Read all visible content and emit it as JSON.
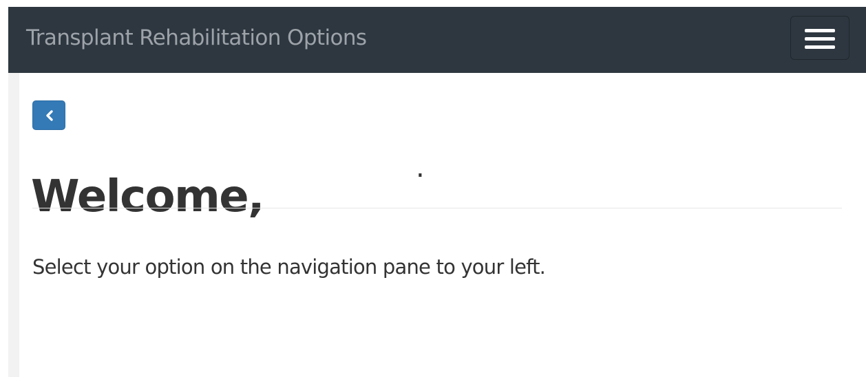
{
  "navbar": {
    "brand": "Transplant Rehabilitation Options",
    "menu_icon": "hamburger-menu-icon"
  },
  "main": {
    "back_icon": "chevron-left-icon",
    "heading": "Welcome,",
    "heading_suffix": ".",
    "instruction": "Select your option on the navigation pane to your left."
  },
  "colors": {
    "navbar_bg": "#2e3740",
    "brand_text": "#9da3a9",
    "back_button": "#337ab7",
    "body_text": "#333333"
  }
}
